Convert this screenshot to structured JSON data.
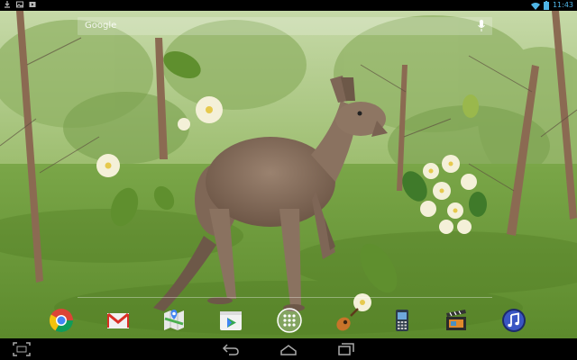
{
  "status_bar": {
    "time": "11:43",
    "left_icons": [
      "download-icon",
      "image-icon",
      "media-icon"
    ],
    "right_icons": [
      "wifi-icon",
      "battery-icon"
    ]
  },
  "search": {
    "hint": "Google",
    "icons": [
      "mic-icon"
    ]
  },
  "dock": {
    "apps": [
      "chrome-icon",
      "gmail-icon",
      "maps-icon",
      "play-store-icon",
      "apps-drawer-icon",
      "guitar-icon",
      "phone-app-icon",
      "movie-studio-icon",
      "music-icon"
    ]
  },
  "nav_bar": {
    "buttons": [
      "screenshot-icon",
      "back-icon",
      "home-icon",
      "recent-apps-icon"
    ]
  },
  "colors": {
    "clock": "#4fb5e6",
    "grass": "#6f9a3a",
    "kangaroo": "#8a7260"
  }
}
